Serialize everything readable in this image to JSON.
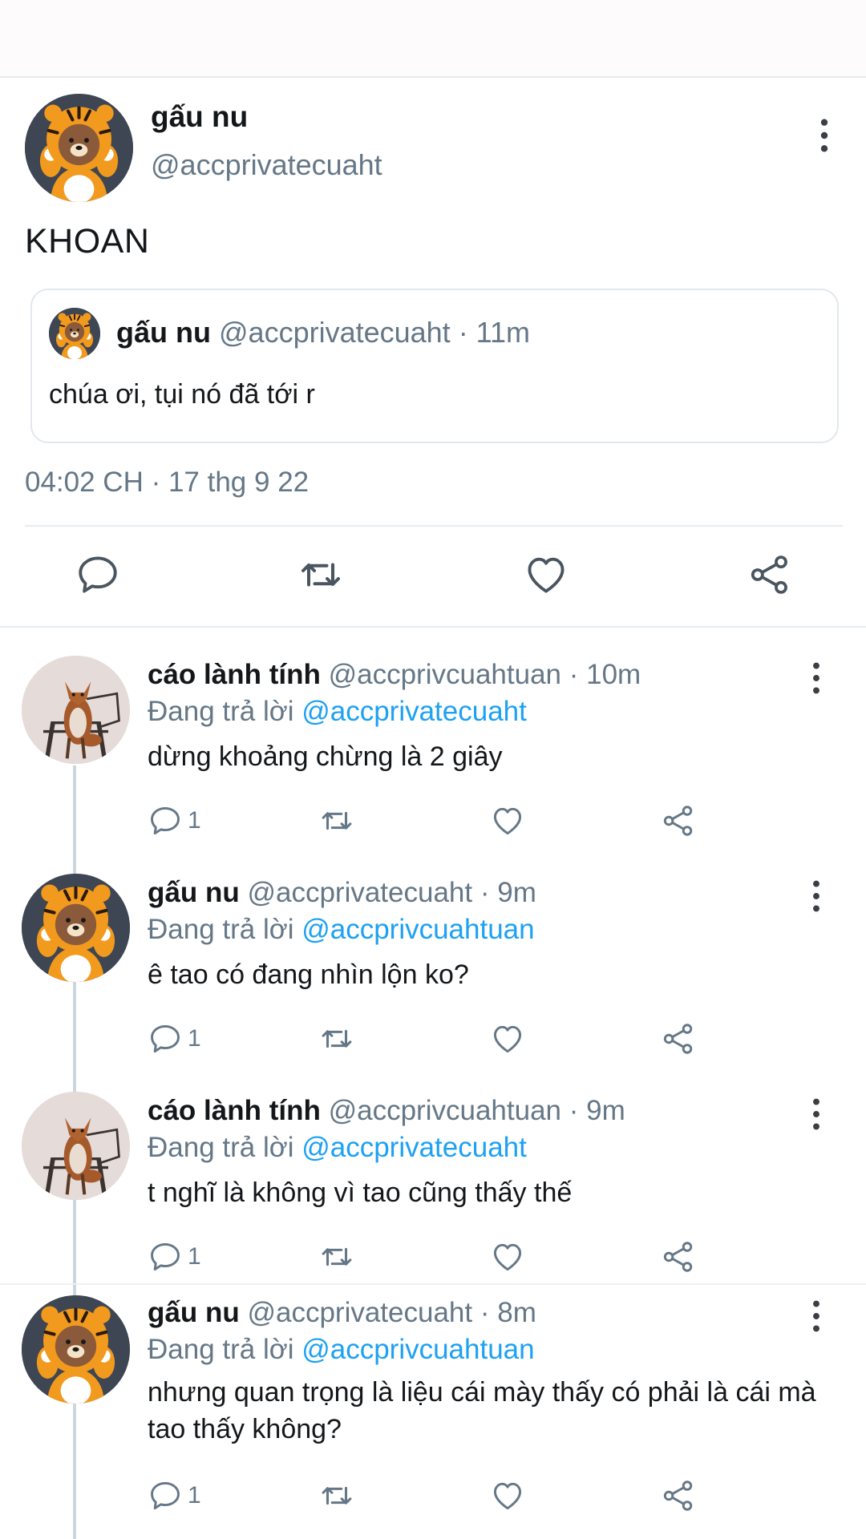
{
  "main_tweet": {
    "author_name": "gấu nu",
    "handle": "@accprivatecuaht",
    "text": "KHOAN",
    "timestamp": "04:02 CH · 17 thg 9 22",
    "avatar_icon": "tiger-costume-bear-avatar",
    "quoted": {
      "author_name": "gấu nu",
      "handle_time": "@accprivatecuaht · 11m",
      "text": "chúa ơi, tụi nó đã tới r"
    }
  },
  "replying_to_label": "Đang trả lời",
  "replies": [
    {
      "author_name": "cáo lành tính",
      "handle_time": "@accprivcuahtuan · 10m",
      "replying_to": "@accprivatecuaht",
      "text": "dừng khoảng chừng là 2 giây",
      "reply_count": "1",
      "avatar": "fox-photo-avatar"
    },
    {
      "author_name": "gấu nu",
      "handle_time": "@accprivatecuaht · 9m",
      "replying_to": "@accprivcuahtuan",
      "text": "ê tao có đang nhìn lộn ko?",
      "reply_count": "1",
      "avatar": "tiger-costume-bear-avatar"
    },
    {
      "author_name": "cáo lành tính",
      "handle_time": "@accprivcuahtuan · 9m",
      "replying_to": "@accprivatecuaht",
      "text": "t nghĩ là không vì tao cũng thấy thế",
      "reply_count": "1",
      "avatar": "fox-photo-avatar"
    },
    {
      "author_name": "gấu nu",
      "handle_time": "@accprivatecuaht · 8m",
      "replying_to": "@accprivcuahtuan",
      "text": "nhưng quan trọng là liệu cái mày thấy có phải là cái mà tao thấy không?",
      "reply_count": "1",
      "avatar": "tiger-costume-bear-avatar"
    }
  ],
  "colors": {
    "text": "#14171a",
    "secondary": "#657786",
    "link": "#1da1f2",
    "border": "#e6ecf0"
  }
}
